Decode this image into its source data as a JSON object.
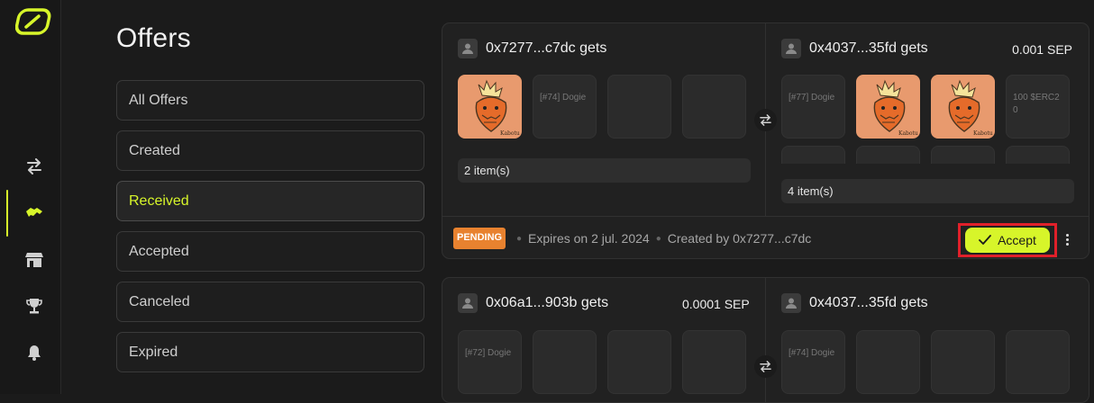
{
  "page": {
    "title": "Offers"
  },
  "sidebar": {
    "icons": [
      "logo-icon",
      "swap-icon",
      "handshake-icon",
      "store-icon",
      "trophy-icon",
      "bell-icon"
    ],
    "active": "handshake-icon",
    "accent": "#d7f52a"
  },
  "filters": [
    {
      "label": "All Offers",
      "active": false
    },
    {
      "label": "Created",
      "active": false
    },
    {
      "label": "Received",
      "active": true
    },
    {
      "label": "Accepted",
      "active": false
    },
    {
      "label": "Canceled",
      "active": false
    },
    {
      "label": "Expired",
      "active": false
    }
  ],
  "offers": [
    {
      "left": {
        "party": "0x7277...c7dc gets",
        "amount": "",
        "tiles": [
          {
            "kind": "image",
            "label": ""
          },
          {
            "kind": "text",
            "label": "[#74] Dogie"
          },
          {
            "kind": "empty",
            "label": ""
          },
          {
            "kind": "empty",
            "label": ""
          }
        ],
        "count": "2 item(s)"
      },
      "right": {
        "party": "0x4037...35fd gets",
        "amount": "0.001 SEP",
        "tiles": [
          {
            "kind": "text",
            "label": "[#77] Dogie"
          },
          {
            "kind": "image",
            "label": ""
          },
          {
            "kind": "image",
            "label": ""
          },
          {
            "kind": "text",
            "label": "100 $ERC20"
          }
        ],
        "count": "4 item(s)"
      },
      "status": "PENDING",
      "status_color": "#e8822f",
      "expires": "Expires on 2 jul. 2024",
      "created_by": "Created by 0x7277...c7dc",
      "accept_label": "Accept"
    },
    {
      "left": {
        "party": "0x06a1...903b gets",
        "amount": "0.0001 SEP",
        "tiles": [
          {
            "kind": "text",
            "label": "[#72] Dogie"
          },
          {
            "kind": "empty",
            "label": ""
          },
          {
            "kind": "empty",
            "label": ""
          },
          {
            "kind": "empty",
            "label": ""
          }
        ]
      },
      "right": {
        "party": "0x4037...35fd gets",
        "amount": "",
        "tiles": [
          {
            "kind": "text",
            "label": "[#74] Dogie"
          },
          {
            "kind": "empty",
            "label": ""
          },
          {
            "kind": "empty",
            "label": ""
          },
          {
            "kind": "empty",
            "label": ""
          }
        ]
      }
    }
  ]
}
